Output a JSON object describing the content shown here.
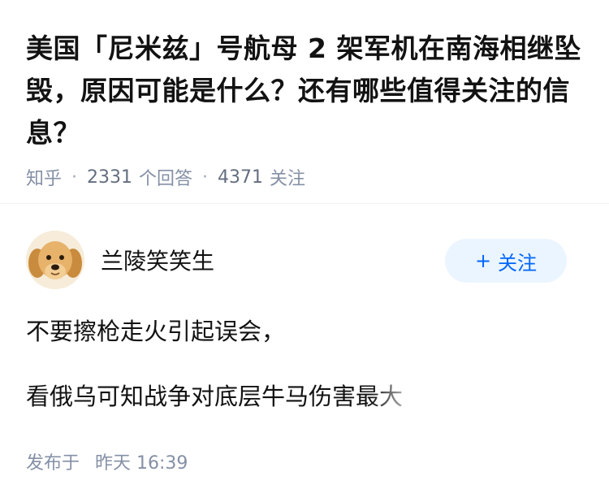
{
  "question": {
    "title": "美国「尼米兹」号航母 2 架军机在南海相继坠毁，原因可能是什么？还有哪些值得关注的信息？",
    "source": "知乎",
    "answers_count": "2331",
    "answers_label": "个回答",
    "followers_count": "4371",
    "followers_label": "关注",
    "separator": "·"
  },
  "author": {
    "name": "兰陵笑笑生",
    "avatar_icon": "dog-avatar",
    "follow_plus": "+",
    "follow_label": "关注"
  },
  "answer": {
    "lines": [
      "不要擦枪走火引起误会，",
      "看俄乌可知战争对底层牛马伤害最大"
    ]
  },
  "footer": {
    "published_label": "发布于",
    "published_time": "昨天 16:39"
  },
  "colors": {
    "title": "#121212",
    "meta": "#8590a6",
    "accent": "#0066ff",
    "follow_bg": "#ebf5ff"
  }
}
